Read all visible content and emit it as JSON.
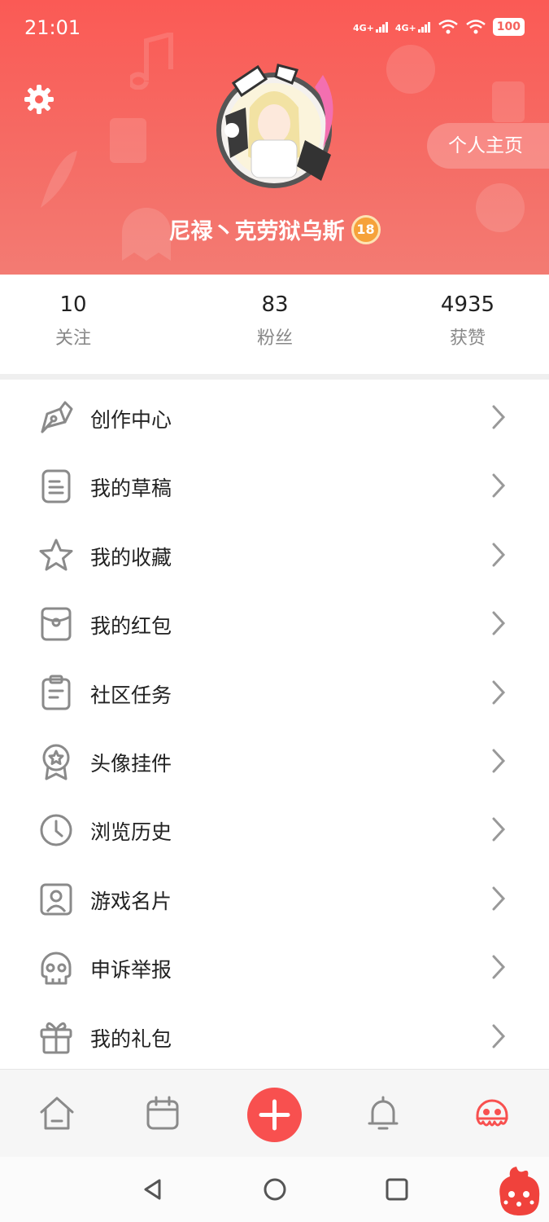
{
  "status": {
    "time": "21:01",
    "net1": "4G+",
    "net2": "4G+",
    "battery": "100"
  },
  "header": {
    "profile_button": "个人主页",
    "username": "尼禄丶克劳狱乌斯",
    "level": "18",
    "accent": "#fb5a55"
  },
  "stats": [
    {
      "value": "10",
      "label": "关注"
    },
    {
      "value": "83",
      "label": "粉丝"
    },
    {
      "value": "4935",
      "label": "获赞"
    }
  ],
  "menu": [
    {
      "label": "创作中心",
      "icon": "pen-icon"
    },
    {
      "label": "我的草稿",
      "icon": "draft-icon"
    },
    {
      "label": "我的收藏",
      "icon": "star-icon"
    },
    {
      "label": "我的红包",
      "icon": "red-packet-icon"
    },
    {
      "label": "社区任务",
      "icon": "clipboard-icon"
    },
    {
      "label": "头像挂件",
      "icon": "badge-icon"
    },
    {
      "label": "浏览历史",
      "icon": "clock-icon"
    },
    {
      "label": "游戏名片",
      "icon": "card-icon"
    },
    {
      "label": "申诉举报",
      "icon": "skull-icon"
    },
    {
      "label": "我的礼包",
      "icon": "gift-icon"
    }
  ],
  "tabbar": {
    "items": [
      "home-icon",
      "calendar-icon",
      "plus-icon",
      "bell-icon",
      "mascot-icon"
    ],
    "active_color": "#f8504f"
  }
}
